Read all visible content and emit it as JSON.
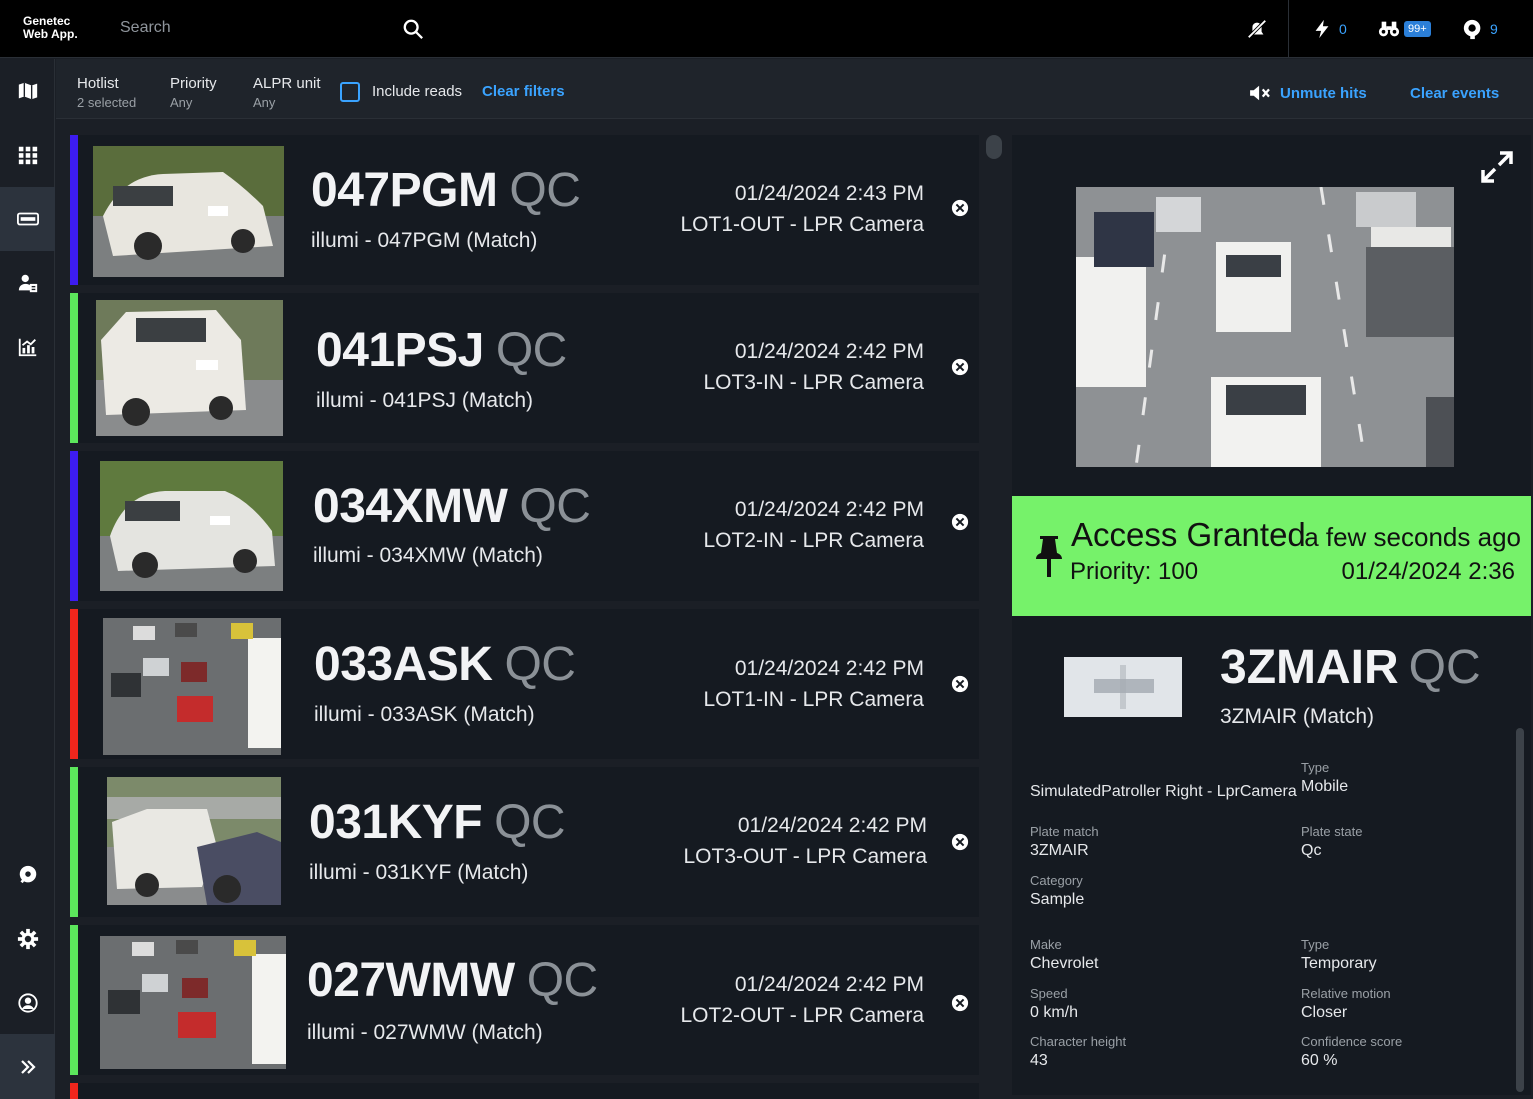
{
  "app": {
    "logo_line1": "Genetec",
    "logo_line2": "Web App."
  },
  "search": {
    "placeholder": "Search"
  },
  "topbar": {
    "events_count": "0",
    "hotlist_badge": "99+",
    "alerts_count": "9"
  },
  "filters": {
    "hotlist_label": "Hotlist",
    "hotlist_value": "2 selected",
    "priority_label": "Priority",
    "priority_value": "Any",
    "unit_label": "ALPR unit",
    "unit_value": "Any",
    "include_reads": "Include reads",
    "clear_filters": "Clear filters",
    "unmute": "Unmute hits",
    "clear_events": "Clear events"
  },
  "events": [
    {
      "plate": "047PGM",
      "state": "QC",
      "sub": "illumi - 047PGM (Match)",
      "datetime": "01/24/2024 2:43 PM",
      "camera": "LOT1-OUT - LPR Camera",
      "color": "#3d1cf0"
    },
    {
      "plate": "041PSJ",
      "state": "QC",
      "sub": "illumi - 041PSJ (Match)",
      "datetime": "01/24/2024 2:42 PM",
      "camera": "LOT3-IN - LPR Camera",
      "color": "#5ce65c"
    },
    {
      "plate": "034XMW",
      "state": "QC",
      "sub": "illumi - 034XMW (Match)",
      "datetime": "01/24/2024 2:42 PM",
      "camera": "LOT2-IN - LPR Camera",
      "color": "#3d1cf0"
    },
    {
      "plate": "033ASK",
      "state": "QC",
      "sub": "illumi - 033ASK (Match)",
      "datetime": "01/24/2024 2:42 PM",
      "camera": "LOT1-IN - LPR Camera",
      "color": "#f0261c"
    },
    {
      "plate": "031KYF",
      "state": "QC",
      "sub": "illumi - 031KYF (Match)",
      "datetime": "01/24/2024 2:42 PM",
      "camera": "LOT3-OUT - LPR Camera",
      "color": "#5ce65c"
    },
    {
      "plate": "027WMW",
      "state": "QC",
      "sub": "illumi - 027WMW (Match)",
      "datetime": "01/24/2024 2:42 PM",
      "camera": "LOT2-OUT - LPR Camera",
      "color": "#5ce65c"
    }
  ],
  "detail": {
    "alarm_title": "Access Granted",
    "alarm_ago": "a few seconds ago",
    "alarm_priority": "Priority: 100",
    "alarm_time": "01/24/2024 2:36",
    "alarm_color": "#76f26a",
    "plate": "3ZMAIR",
    "state": "QC",
    "sub": "3ZMAIR (Match)",
    "camera_value": "SimulatedPatroller Right - LprCamera",
    "type_label": "Type",
    "type_value": "Mobile",
    "plate_match_label": "Plate match",
    "plate_match_value": "3ZMAIR",
    "plate_state_label": "Plate state",
    "plate_state_value": "Qc",
    "category_label": "Category",
    "category_value": "Sample",
    "make_label": "Make",
    "make_value": "Chevrolet",
    "type2_label": "Type",
    "type2_value": "Temporary",
    "speed_label": "Speed",
    "speed_value": "0 km/h",
    "motion_label": "Relative motion",
    "motion_value": "Closer",
    "char_label": "Character height",
    "char_value": "43",
    "conf_label": "Confidence score",
    "conf_value": "60 %"
  }
}
